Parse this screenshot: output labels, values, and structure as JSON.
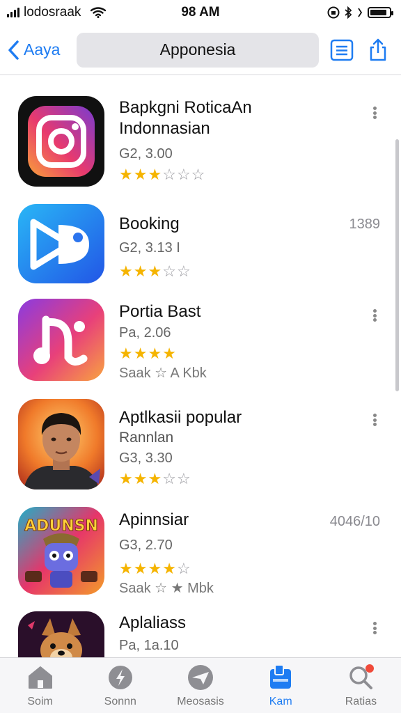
{
  "status_bar": {
    "carrier": "lodosraak",
    "time": "98 AM",
    "colors": {
      "text": "#111111"
    }
  },
  "nav": {
    "back_label": "Aaya",
    "title": "Apponesia",
    "icons": [
      "list-icon",
      "share-icon"
    ],
    "accent": "#1e7cf2"
  },
  "apps": [
    {
      "name": "Bapkgni RoticaAn",
      "subtitle": "Indonnasian",
      "meta": "G2, 3.00",
      "rating": 3,
      "max_rating": 6,
      "extra": "",
      "right": "",
      "icon": "camera-icon"
    },
    {
      "name": "Booking",
      "subtitle": "",
      "meta": "G2, 3.13 I",
      "rating": 3,
      "max_rating": 5,
      "extra": "",
      "right": "1389",
      "icon": "play-icon"
    },
    {
      "name": "Portia Bast",
      "subtitle": "",
      "meta": "Pa, 2.06",
      "rating": 4,
      "max_rating": 4,
      "extra": "Saak ☆ A Kbk",
      "right": "",
      "icon": "music-note-icon"
    },
    {
      "name": "Aptlkasii popular",
      "subtitle": "Rannlan",
      "meta": "G3, 3.30",
      "rating": 3,
      "max_rating": 5,
      "extra": "",
      "right": "",
      "icon": "portrait-icon"
    },
    {
      "name": "Apinnsiar",
      "subtitle": "",
      "meta": "G3, 2.70",
      "rating": 4,
      "max_rating": 5,
      "extra": "Saak ☆ ★ Mbk",
      "right": "4046/10",
      "icon": "robot-game-icon",
      "icon_text": "ADUNSN"
    },
    {
      "name": "Aplaliass",
      "subtitle": "",
      "meta": "Pa, 1a.10",
      "rating": 0,
      "max_rating": 0,
      "extra": "",
      "right": "",
      "icon": "dog-game-icon"
    }
  ],
  "tabs": [
    {
      "label": "Soim",
      "icon": "home-icon",
      "active": false
    },
    {
      "label": "Sonnn",
      "icon": "lightning-icon",
      "active": false
    },
    {
      "label": "Meosasis",
      "icon": "paper-plane-icon",
      "active": false
    },
    {
      "label": "Kam",
      "icon": "stack-icon",
      "active": true
    },
    {
      "label": "Ratias",
      "icon": "search-icon",
      "active": false
    }
  ],
  "colors": {
    "star_on": "#f5b400",
    "star_off": "#9a9aa0",
    "badge": "#f04a3a"
  }
}
